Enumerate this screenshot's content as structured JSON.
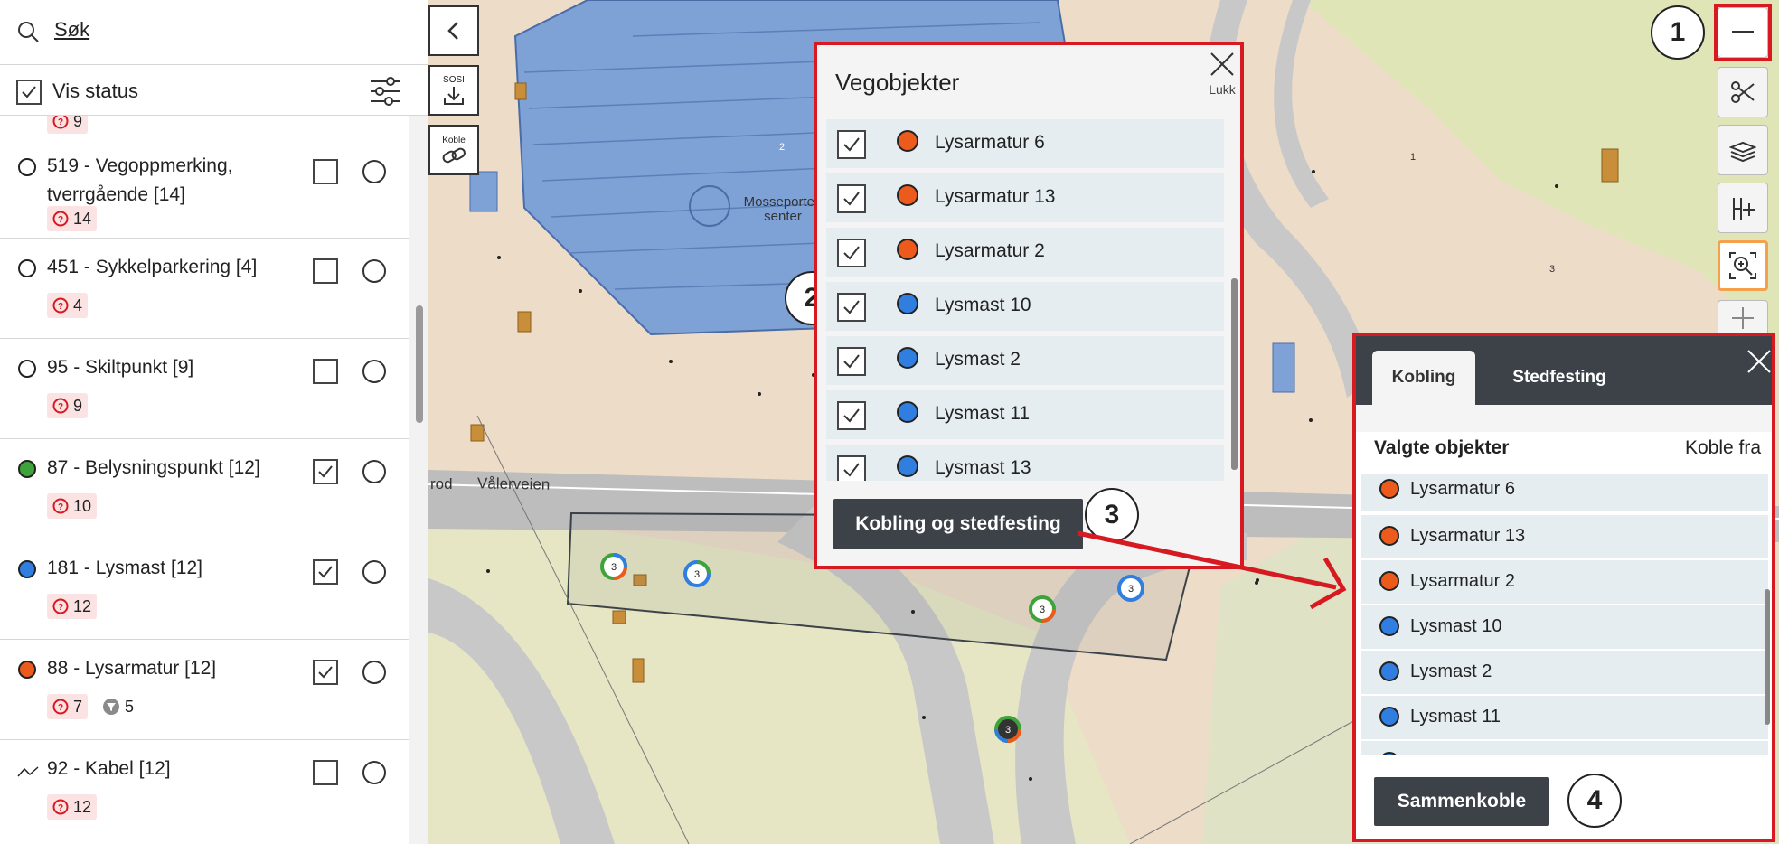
{
  "search": {
    "label": "Søk"
  },
  "status": {
    "label": "Vis status"
  },
  "sidebar": {
    "top_partial_count": "9",
    "rows": [
      {
        "name": "519 - Vegoppmerking, tverrgående [14]",
        "badge": "14",
        "checked": false
      },
      {
        "name": "451 - Sykkelparkering [4]",
        "badge": "4",
        "checked": false
      },
      {
        "name": "95 - Skiltpunkt [9]",
        "badge": "9",
        "checked": false
      },
      {
        "name": "87 - Belysningspunkt [12]",
        "badge": "10",
        "checked": true,
        "color": "#3da33a"
      },
      {
        "name": "181 - Lysmast [12]",
        "badge": "12",
        "checked": true,
        "color": "#2f7ee0"
      },
      {
        "name": "88 - Lysarmatur [12]",
        "badge": "7",
        "badge2": "5",
        "checked": true,
        "color": "#ec5a1c"
      },
      {
        "name": "92 - Kabel [12]",
        "badge": "12",
        "checked": false
      }
    ]
  },
  "map_tools": {
    "sosi": "SOSI",
    "koble": "Koble"
  },
  "map_labels": {
    "road": "Vålerveien",
    "road_partial": "rod",
    "centre": "Mosseporten senter",
    "n1": "1",
    "n2": "2",
    "n3": "3",
    "cluster": "3"
  },
  "steps": {
    "s1": "1",
    "s2": "2",
    "s3": "3",
    "s4": "4"
  },
  "popup": {
    "title": "Vegobjekter",
    "close_label": "Lukk",
    "items": [
      {
        "label": "Lysarmatur 6",
        "color": "#ec5a1c"
      },
      {
        "label": "Lysarmatur 13",
        "color": "#ec5a1c"
      },
      {
        "label": "Lysarmatur 2",
        "color": "#ec5a1c"
      },
      {
        "label": "Lysmast 10",
        "color": "#2f7ee0"
      },
      {
        "label": "Lysmast 2",
        "color": "#2f7ee0"
      },
      {
        "label": "Lysmast 11",
        "color": "#2f7ee0"
      },
      {
        "label": "Lysmast 13",
        "color": "#2f7ee0"
      }
    ],
    "button": "Kobling og stedfesting"
  },
  "panel": {
    "tab_active": "Kobling",
    "tab_inactive": "Stedfesting",
    "subtitle": "Valgte objekter",
    "koble_fra": "Koble fra",
    "items": [
      {
        "label": "Lysarmatur 6",
        "color": "#ec5a1c"
      },
      {
        "label": "Lysarmatur 13",
        "color": "#ec5a1c"
      },
      {
        "label": "Lysarmatur 2",
        "color": "#ec5a1c"
      },
      {
        "label": "Lysmast 10",
        "color": "#2f7ee0"
      },
      {
        "label": "Lysmast 2",
        "color": "#2f7ee0"
      },
      {
        "label": "Lysmast 11",
        "color": "#2f7ee0"
      }
    ],
    "button": "Sammenkoble"
  },
  "colors": {
    "accent_red": "#d71921",
    "dark": "#3c4248",
    "building": "#7ea1d6",
    "ground": "#f2dcc5"
  }
}
